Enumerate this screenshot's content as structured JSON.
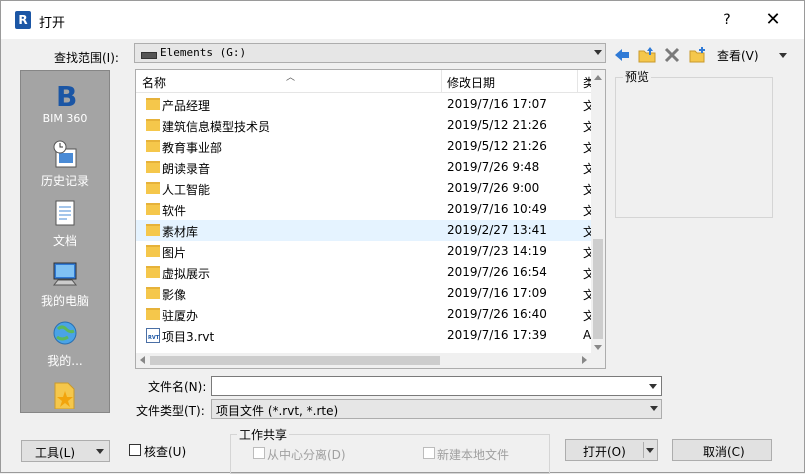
{
  "window": {
    "title": "打开",
    "help": "?",
    "close": "✕"
  },
  "lookin": {
    "label": "查找范围(I):",
    "value": "Elements (G:)"
  },
  "toolbar": {
    "views_label": "查看(V)"
  },
  "places": [
    {
      "label": "BIM 360",
      "icon": "bim360-icon"
    },
    {
      "label": "历史记录",
      "icon": "history-icon"
    },
    {
      "label": "文档",
      "icon": "documents-icon"
    },
    {
      "label": "我的电脑",
      "icon": "my-computer-icon"
    },
    {
      "label": "我的...",
      "icon": "network-icon"
    },
    {
      "label": "",
      "icon": "favorites-icon"
    }
  ],
  "columns": {
    "name": "名称",
    "date": "修改日期",
    "type": "类"
  },
  "files": [
    {
      "name": "产品经理",
      "date": "2019/7/16 17:07",
      "type": "文",
      "kind": "folder"
    },
    {
      "name": "建筑信息模型技术员",
      "date": "2019/5/12 21:26",
      "type": "文",
      "kind": "folder"
    },
    {
      "name": "教育事业部",
      "date": "2019/5/12 21:26",
      "type": "文",
      "kind": "folder"
    },
    {
      "name": "朗读录音",
      "date": "2019/7/26 9:48",
      "type": "文",
      "kind": "folder"
    },
    {
      "name": "人工智能",
      "date": "2019/7/26 9:00",
      "type": "文",
      "kind": "folder"
    },
    {
      "name": "软件",
      "date": "2019/7/16 10:49",
      "type": "文",
      "kind": "folder"
    },
    {
      "name": "素材库",
      "date": "2019/2/27 13:41",
      "type": "文",
      "kind": "folder",
      "selected": true
    },
    {
      "name": "图片",
      "date": "2019/7/23 14:19",
      "type": "文",
      "kind": "folder"
    },
    {
      "name": "虚拟展示",
      "date": "2019/7/26 16:54",
      "type": "文",
      "kind": "folder"
    },
    {
      "name": "影像",
      "date": "2019/7/16 17:09",
      "type": "文",
      "kind": "folder"
    },
    {
      "name": "驻厦办",
      "date": "2019/7/26 16:40",
      "type": "文",
      "kind": "folder"
    },
    {
      "name": "项目3.rvt",
      "date": "2019/7/16 17:39",
      "type": "A",
      "kind": "rvt"
    }
  ],
  "preview": {
    "label": "预览"
  },
  "filename": {
    "label": "文件名(N):",
    "value": ""
  },
  "filetype": {
    "label": "文件类型(T):",
    "value": "项目文件 (*.rvt, *.rte)"
  },
  "buttons": {
    "tools": "工具(L)",
    "open": "打开(O)",
    "cancel": "取消(C)"
  },
  "audit": {
    "label": "核查(U)"
  },
  "worksharing": {
    "title": "工作共享",
    "detach": "从中心分离(D)",
    "new_local": "新建本地文件"
  },
  "colors": {
    "places_bg": "#a4a4a4",
    "selection": "#e5f3ff",
    "folder": "#f5c74b",
    "accent": "#1b56a5"
  }
}
